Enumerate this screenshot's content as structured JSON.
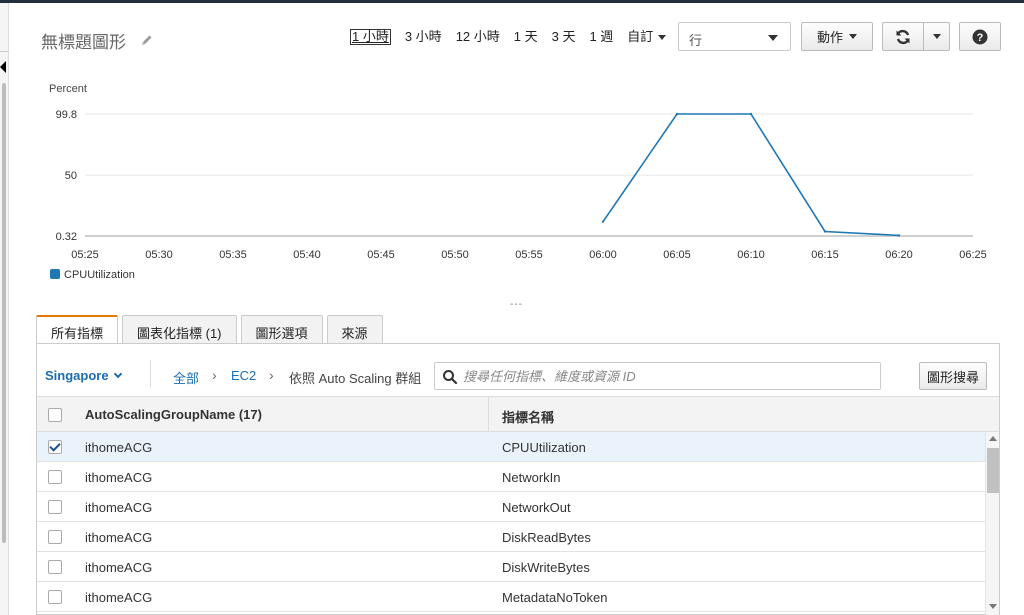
{
  "title": "無標題圖形",
  "time_ranges": [
    "1 小時",
    "3 小時",
    "12 小時",
    "1 天",
    "3 天",
    "1 週"
  ],
  "custom_range": "自訂",
  "view_select": "行",
  "actions_label": "動作",
  "help_label": "?",
  "chart_data": {
    "type": "line",
    "ylabel": "Percent",
    "y_ticks": [
      0.32,
      50,
      99.8
    ],
    "ylim": [
      0.32,
      99.8
    ],
    "x_ticks": [
      "05:25",
      "05:30",
      "05:35",
      "05:40",
      "05:45",
      "05:50",
      "05:55",
      "06:00",
      "06:05",
      "06:10",
      "06:15",
      "06:20",
      "06:25"
    ],
    "series": [
      {
        "name": "CPUUtilization",
        "color": "#1f77b4",
        "points": [
          {
            "x": "06:00",
            "y": 12
          },
          {
            "x": "06:05",
            "y": 99.8
          },
          {
            "x": "06:10",
            "y": 99.8
          },
          {
            "x": "06:15",
            "y": 4
          },
          {
            "x": "06:20",
            "y": 0.8
          }
        ]
      }
    ],
    "grid": "horizontal",
    "legend": "bottom-left"
  },
  "resize_handle": "---",
  "tabs": [
    "所有指標",
    "圖表化指標 (1)",
    "圖形選項",
    "來源"
  ],
  "region": "Singapore",
  "breadcrumb": {
    "all": "全部",
    "ec2": "EC2",
    "current": "依照 Auto Scaling 群組",
    "sep": "›"
  },
  "search_placeholder": "搜尋任何指標、維度或資源 ID",
  "graph_search_label": "圖形搜尋",
  "table": {
    "col1": "AutoScalingGroupName (17)",
    "col2": "指標名稱",
    "rows": [
      {
        "group": "ithomeACG",
        "metric": "CPUUtilization"
      },
      {
        "group": "ithomeACG",
        "metric": "NetworkIn"
      },
      {
        "group": "ithomeACG",
        "metric": "NetworkOut"
      },
      {
        "group": "ithomeACG",
        "metric": "DiskReadBytes"
      },
      {
        "group": "ithomeACG",
        "metric": "DiskWriteBytes"
      },
      {
        "group": "ithomeACG",
        "metric": "MetadataNoToken"
      }
    ]
  }
}
